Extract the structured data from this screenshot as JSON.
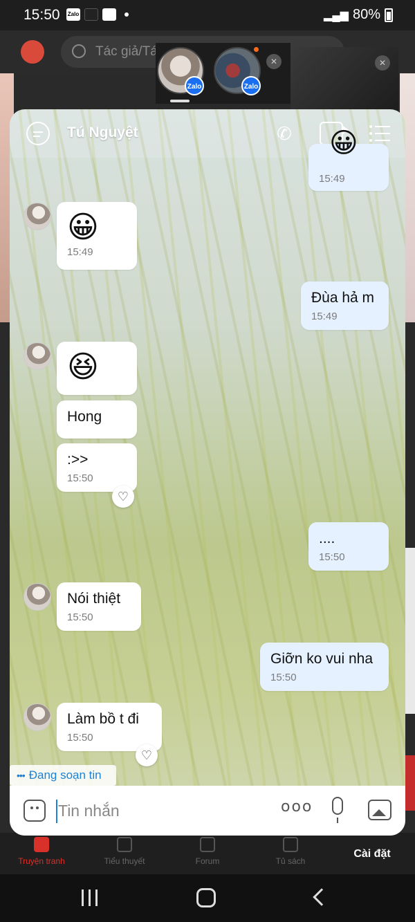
{
  "status_bar": {
    "time": "15:50",
    "battery": "80%"
  },
  "background_app": {
    "search_placeholder": "Tác giả/Tá",
    "tabs": [
      {
        "label": "Truyện tranh"
      },
      {
        "label": "Tiểu thuyết"
      },
      {
        "label": "Forum"
      },
      {
        "label": "Tủ sách"
      },
      {
        "label": "Cài đặt"
      }
    ]
  },
  "call_bubbles": {
    "badge": "Zalo"
  },
  "chat": {
    "contact_name": "Tú Nguyệt",
    "messages": [
      {
        "time": "15:49"
      },
      {
        "emoji": "😀",
        "time": "15:49"
      },
      {
        "text": "Đùa hả m",
        "time": "15:49"
      },
      {
        "emoji": "😆"
      },
      {
        "text": "Hong"
      },
      {
        "text": ":>>",
        "time": "15:50"
      },
      {
        "text": "....",
        "time": "15:50"
      },
      {
        "text": "Nói thiệt",
        "time": "15:50"
      },
      {
        "text": "Giỡn ko vui nha",
        "time": "15:50"
      },
      {
        "text": "Làm bồ t đi",
        "time": "15:50"
      }
    ],
    "typing_indicator": "Đang soạn tin",
    "input_placeholder": "Tin nhắn",
    "more_glyph": "ooo"
  },
  "colors": {
    "accent_blue": "#1c82d6",
    "active_tab_red": "#d8312a",
    "my_bubble": "#e5f1ff"
  },
  "icons": [
    "message-icon",
    "phone-icon",
    "video-call-icon",
    "menu-icon",
    "emoji-icon",
    "more-icon",
    "mic-icon",
    "image-icon",
    "heart-icon"
  ]
}
